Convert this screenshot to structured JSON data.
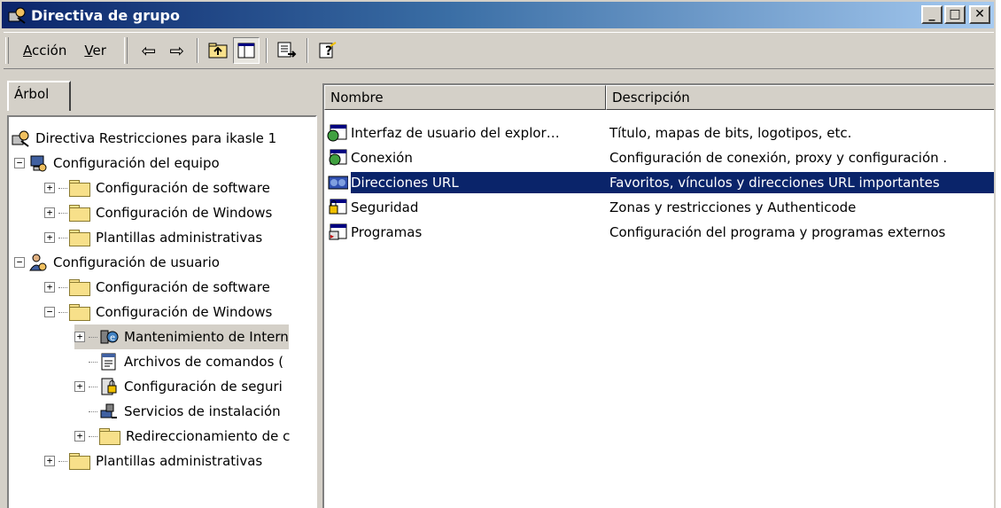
{
  "window": {
    "title": "Directiva de grupo",
    "icon": "group-policy-icon",
    "controls": {
      "minimize": "_",
      "maximize": "□",
      "close": "✕"
    }
  },
  "toolbar": {
    "menu": [
      {
        "label": "Acción",
        "accel": "A",
        "rest": "cción"
      },
      {
        "label": "Ver",
        "accel": "V",
        "rest": "er"
      }
    ],
    "buttons": [
      {
        "name": "back-button",
        "icon": "arrow-left-icon",
        "glyph": "⇦"
      },
      {
        "name": "forward-button",
        "icon": "arrow-right-icon",
        "glyph": "⇨"
      },
      {
        "name": "up-one-level-button",
        "icon": "folder-up-icon",
        "glyph": "⤴"
      },
      {
        "name": "show-hide-tree-button",
        "icon": "tree-toggle-icon",
        "glyph": "▦"
      },
      {
        "name": "export-list-button",
        "icon": "export-icon",
        "glyph": "⎘"
      },
      {
        "name": "help-button",
        "icon": "help-icon",
        "glyph": "?"
      }
    ]
  },
  "tab": {
    "label": "Árbol"
  },
  "tree": {
    "items": [
      {
        "label": "Directiva Restricciones para ikasle 1",
        "icon": "policy-icon",
        "level": 0,
        "expander": ""
      },
      {
        "label": "Configuración del equipo",
        "icon": "computer-icon",
        "level": 1,
        "expander": "−"
      },
      {
        "label": "Configuración de software",
        "icon": "folder-icon",
        "level": 2,
        "expander": "+"
      },
      {
        "label": "Configuración de Windows",
        "icon": "folder-icon",
        "level": 2,
        "expander": "+"
      },
      {
        "label": "Plantillas administrativas",
        "icon": "folder-icon",
        "level": 2,
        "expander": "+"
      },
      {
        "label": "Configuración de usuario",
        "icon": "user-icon",
        "level": 1,
        "expander": "−"
      },
      {
        "label": "Configuración de software",
        "icon": "folder-icon",
        "level": 2,
        "expander": "+"
      },
      {
        "label": "Configuración de Windows",
        "icon": "folder-icon",
        "level": 2,
        "expander": "−"
      },
      {
        "label": "Mantenimiento de Intern",
        "icon": "ie-maintenance-icon",
        "level": 3,
        "expander": "+",
        "selected": true
      },
      {
        "label": "Archivos de comandos (",
        "icon": "script-icon",
        "level": 3,
        "expander": ""
      },
      {
        "label": "Configuración de seguri",
        "icon": "security-icon",
        "level": 3,
        "expander": "+"
      },
      {
        "label": "Servicios de instalación",
        "icon": "install-icon",
        "level": 3,
        "expander": ""
      },
      {
        "label": "Redireccionamiento de c",
        "icon": "folder-icon",
        "level": 3,
        "expander": "+"
      },
      {
        "label": "Plantillas administrativas",
        "icon": "folder-icon",
        "level": 2,
        "expander": "+"
      }
    ]
  },
  "list": {
    "columns": [
      "Nombre",
      "Descripción"
    ],
    "rows": [
      {
        "name": "Interfaz de usuario del explor…",
        "description": "Título, mapas de bits, logotipos, etc.",
        "icon": "browser-ui-icon",
        "selected": false
      },
      {
        "name": "Conexión",
        "description": "Configuración de conexión, proxy y configuración .",
        "icon": "connection-icon",
        "selected": false
      },
      {
        "name": "Direcciones URL",
        "description": "Favoritos, vínculos y direcciones URL importantes",
        "icon": "url-icon",
        "selected": true
      },
      {
        "name": "Seguridad",
        "description": "Zonas y restricciones y Authenticode",
        "icon": "security-icon",
        "selected": false
      },
      {
        "name": "Programas",
        "description": "Configuración del programa y programas externos",
        "icon": "programs-icon",
        "selected": false
      }
    ]
  },
  "colors": {
    "title_start": "#0a246a",
    "title_end": "#a6caf0",
    "selection": "#0a246a",
    "face": "#d4d0c8"
  }
}
